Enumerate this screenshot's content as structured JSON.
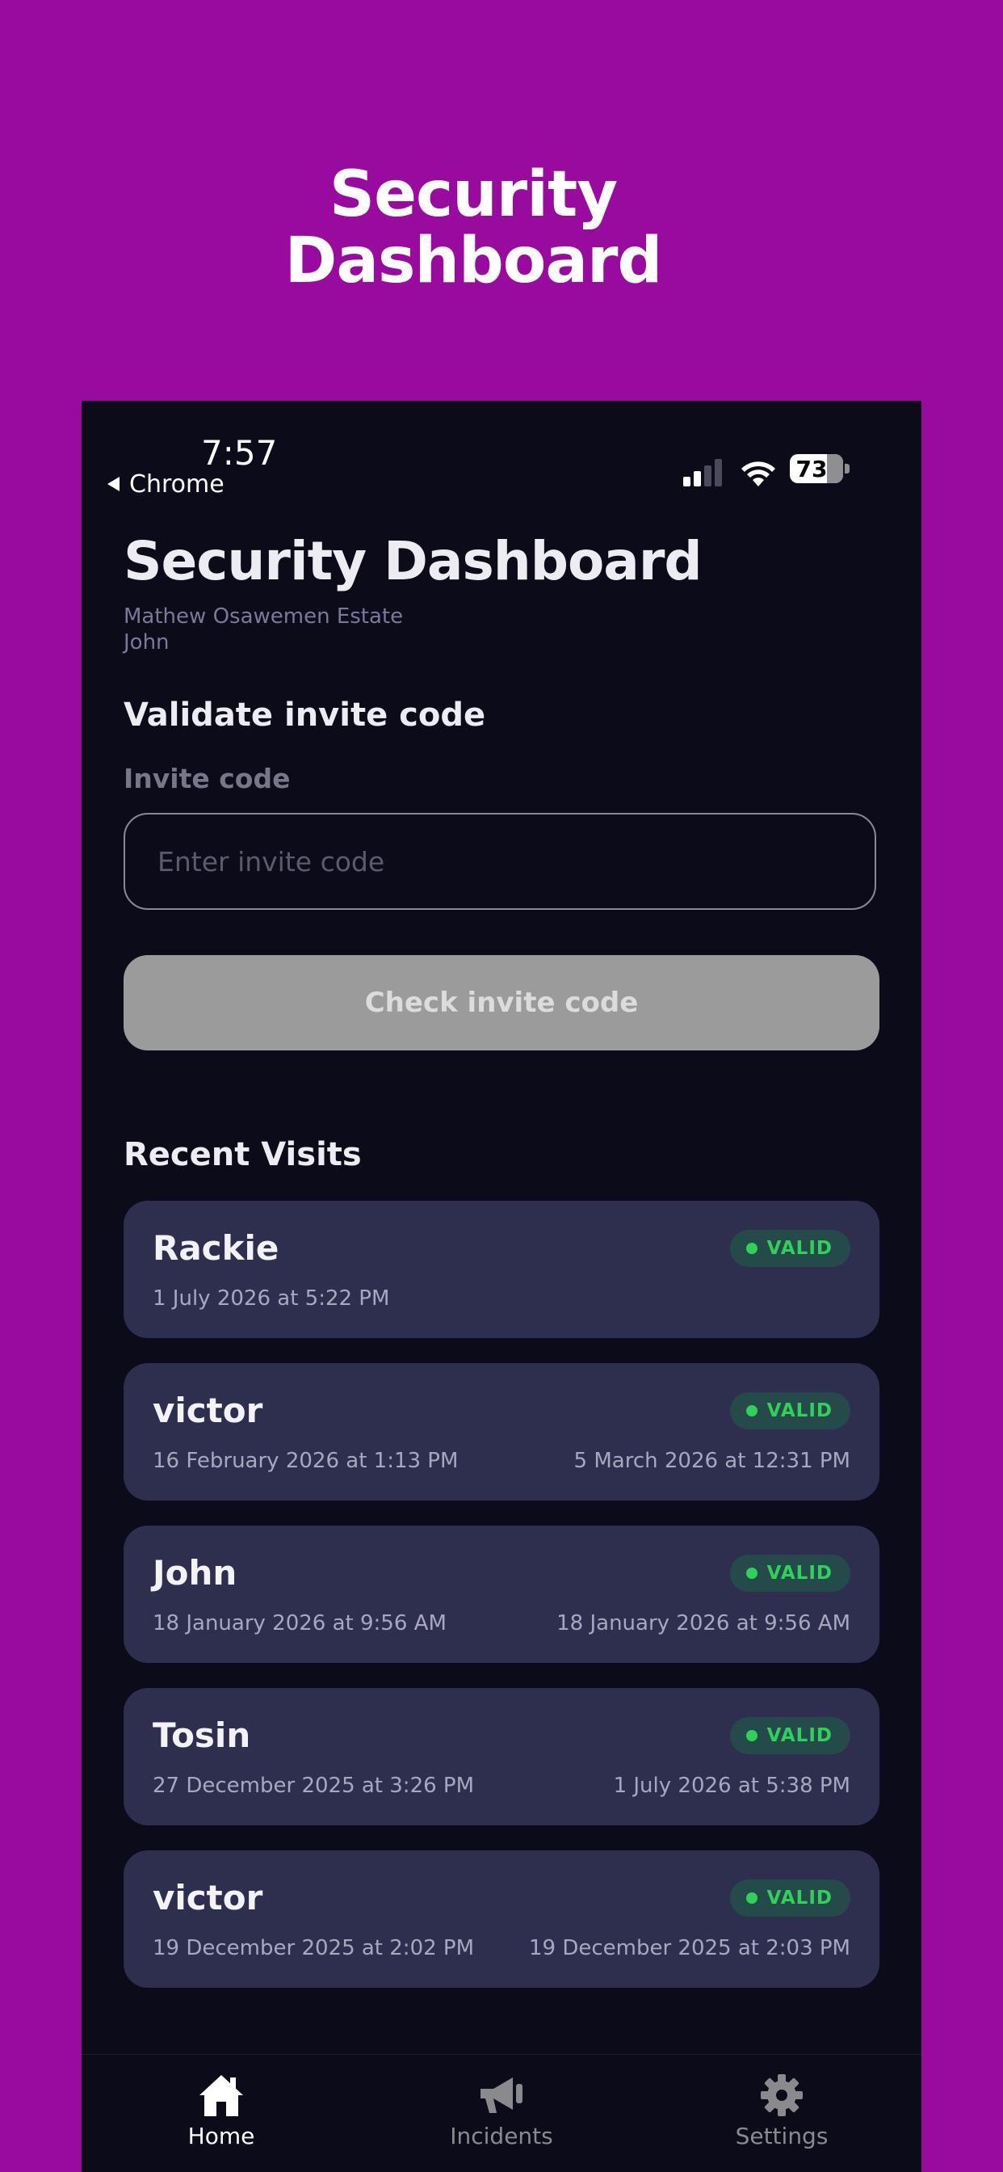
{
  "promo": {
    "title_line1": "Security",
    "title_line2": "Dashboard"
  },
  "status_bar": {
    "time": "7:57",
    "back_app": "Chrome",
    "battery": "73"
  },
  "header": {
    "title": "Security Dashboard",
    "estate": "Mathew Osawemen Estate",
    "user": "John"
  },
  "validate": {
    "heading": "Validate invite code",
    "field_label": "Invite code",
    "placeholder": "Enter invite code",
    "button_label": "Check invite code"
  },
  "recent": {
    "heading": "Recent Visits",
    "visits": [
      {
        "name": "Rackie",
        "status": "VALID",
        "start": "1 July 2026 at 5:22 PM",
        "end": ""
      },
      {
        "name": "victor",
        "status": "VALID",
        "start": "16 February 2026 at 1:13 PM",
        "end": "5 March 2026 at 12:31 PM"
      },
      {
        "name": "John",
        "status": "VALID",
        "start": "18 January 2026 at 9:56 AM",
        "end": "18 January 2026 at 9:56 AM"
      },
      {
        "name": "Tosin",
        "status": "VALID",
        "start": "27 December 2025 at 3:26 PM",
        "end": "1 July 2026 at 5:38 PM"
      },
      {
        "name": "victor",
        "status": "VALID",
        "start": "19 December 2025 at 2:02 PM",
        "end": "19 December 2025 at 2:03 PM"
      }
    ]
  },
  "tabs": [
    {
      "label": "Home",
      "icon": "home-icon",
      "active": true
    },
    {
      "label": "Incidents",
      "icon": "megaphone-icon",
      "active": false
    },
    {
      "label": "Settings",
      "icon": "gear-icon",
      "active": false
    }
  ],
  "colors": {
    "promo_background": "#990a9e",
    "app_background": "#0c0b1a",
    "card_background": "#2e2f4e",
    "valid_green": "#30d158",
    "tab_active": "#ffffff",
    "tab_inactive": "#8a8a8e"
  }
}
